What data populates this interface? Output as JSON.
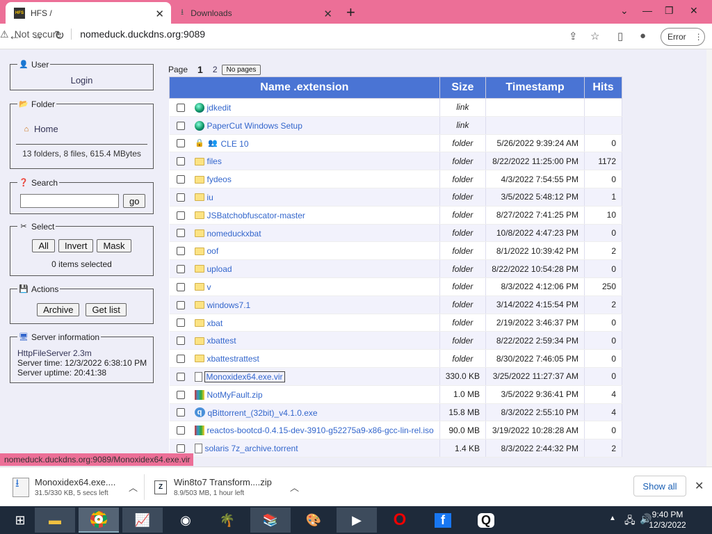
{
  "browser": {
    "tabs": [
      {
        "title": "HFS /",
        "favicon": "HFS"
      },
      {
        "title": "Downloads"
      }
    ],
    "not_secure": "Not secure",
    "url": "nomeduck.duckdns.org:9089",
    "error_label": "Error"
  },
  "sidebar": {
    "user": {
      "legend": "User",
      "login": "Login"
    },
    "folder": {
      "legend": "Folder",
      "home": "Home",
      "summary": "13 folders, 8 files, 615.4 MBytes"
    },
    "search": {
      "legend": "Search",
      "go": "go"
    },
    "select": {
      "legend": "Select",
      "all": "All",
      "invert": "Invert",
      "mask": "Mask",
      "status": "0 items selected"
    },
    "actions": {
      "legend": "Actions",
      "archive": "Archive",
      "get_list": "Get list"
    },
    "server": {
      "legend": "Server information",
      "version": "HttpFileServer 2.3m",
      "time": "Server time: 12/3/2022 6:38:10 PM",
      "uptime": "Server uptime: 20:41:38"
    }
  },
  "pager": {
    "label": "Page",
    "current": "1",
    "next": "2",
    "no_pages": "No pages"
  },
  "table": {
    "headers": [
      "Name .extension",
      "Size",
      "Timestamp",
      "Hits"
    ],
    "rows": [
      {
        "icon": "globe",
        "name": "jdkedit",
        "size": "link",
        "time": "",
        "hits": ""
      },
      {
        "icon": "globe",
        "name": "PaperCut Windows Setup",
        "size": "link",
        "time": "",
        "hits": ""
      },
      {
        "icon": "locked",
        "name": "CLE 10",
        "size": "folder",
        "time": "5/26/2022 9:39:24 AM",
        "hits": "0"
      },
      {
        "icon": "folder",
        "name": "files",
        "size": "folder",
        "time": "8/22/2022 11:25:00 PM",
        "hits": "1172"
      },
      {
        "icon": "folder",
        "name": "fydeos",
        "size": "folder",
        "time": "4/3/2022 7:54:55 PM",
        "hits": "0"
      },
      {
        "icon": "folder",
        "name": "iu",
        "size": "folder",
        "time": "3/5/2022 5:48:12 PM",
        "hits": "1"
      },
      {
        "icon": "folder",
        "name": "JSBatchobfuscator-master",
        "size": "folder",
        "time": "8/27/2022 7:41:25 PM",
        "hits": "10"
      },
      {
        "icon": "folder",
        "name": "nomeduckxbat",
        "size": "folder",
        "time": "10/8/2022 4:47:23 PM",
        "hits": "0"
      },
      {
        "icon": "folder",
        "name": "oof",
        "size": "folder",
        "time": "8/1/2022 10:39:42 PM",
        "hits": "2"
      },
      {
        "icon": "folder",
        "name": "upload",
        "size": "folder",
        "time": "8/22/2022 10:54:28 PM",
        "hits": "0"
      },
      {
        "icon": "folder",
        "name": "v",
        "size": "folder",
        "time": "8/3/2022 4:12:06 PM",
        "hits": "250"
      },
      {
        "icon": "folder",
        "name": "windows7.1",
        "size": "folder",
        "time": "3/14/2022 4:15:54 PM",
        "hits": "2"
      },
      {
        "icon": "folder",
        "name": "xbat",
        "size": "folder",
        "time": "2/19/2022 3:46:37 PM",
        "hits": "0"
      },
      {
        "icon": "folder",
        "name": "xbattest",
        "size": "folder",
        "time": "8/22/2022 2:59:34 PM",
        "hits": "0"
      },
      {
        "icon": "folder",
        "name": "xbattestrattest",
        "size": "folder",
        "time": "8/30/2022 7:46:05 PM",
        "hits": "0"
      },
      {
        "icon": "doc",
        "name": "Monoxidex64.exe.vir",
        "size": "330.0 KB",
        "time": "3/25/2022 11:27:37 AM",
        "hits": "0"
      },
      {
        "icon": "zip",
        "name": "NotMyFault.zip",
        "size": "1.0 MB",
        "time": "3/5/2022 9:36:41 PM",
        "hits": "4"
      },
      {
        "icon": "exe",
        "name": "qBittorrent_(32bit)_v4.1.0.exe",
        "size": "15.8 MB",
        "time": "8/3/2022 2:55:10 PM",
        "hits": "4"
      },
      {
        "icon": "zip",
        "name": "reactos-bootcd-0.4.15-dev-3910-g52275a9-x86-gcc-lin-rel.iso",
        "size": "90.0 MB",
        "time": "3/19/2022 10:28:28 AM",
        "hits": "0"
      },
      {
        "icon": "doc",
        "name": "solaris 7z_archive.torrent",
        "size": "1.4 KB",
        "time": "8/3/2022 2:44:32 PM",
        "hits": "2"
      }
    ]
  },
  "status_url": "nomeduck.duckdns.org:9089/Monoxidex64.exe.vir",
  "downloads": [
    {
      "name": "Monoxidex64.exe....",
      "status": "31.5/330 KB, 5 secs left"
    },
    {
      "name": "Win8to7 Transform....zip",
      "status": "8.9/503 MB, 1 hour left"
    }
  ],
  "show_all": "Show all",
  "taskbar": {
    "time": "9:40 PM",
    "date": "12/3/2022"
  }
}
